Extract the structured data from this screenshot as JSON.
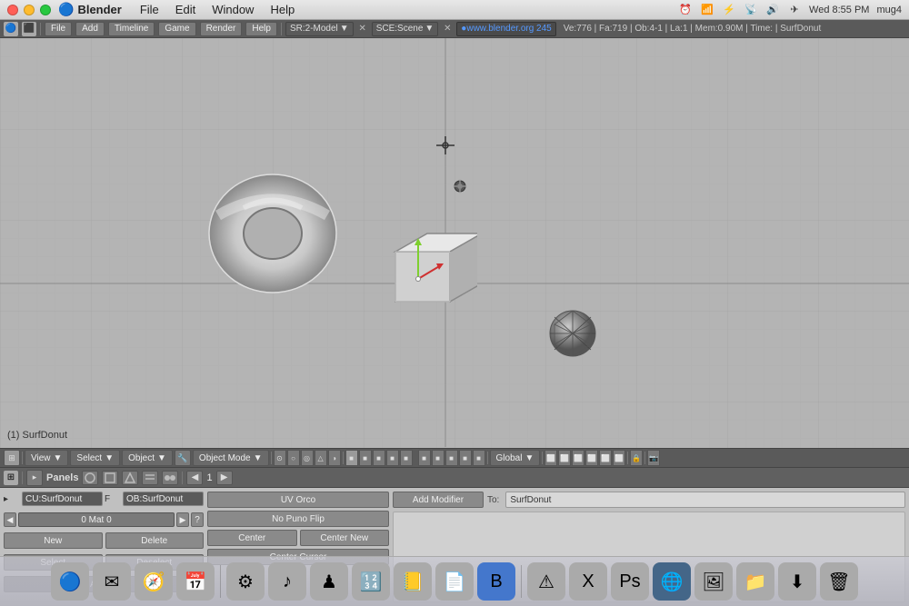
{
  "titlebar": {
    "app_name": "Blender",
    "window_menu": "Window",
    "time": "Wed 8:55 PM",
    "user": "mug4"
  },
  "macos_menu": {
    "apple_label": "",
    "app": "Blender",
    "items": [
      "File",
      "Edit",
      "Window",
      "Help"
    ]
  },
  "blender_header": {
    "title": "Blender",
    "menu_items": [
      "File",
      "Add",
      "Timeline",
      "Game",
      "Render",
      "Help"
    ],
    "sr_field": "SR:2-Model",
    "sce_field": "SCE:Scene",
    "url": "www.blender.org 245",
    "stats": "Ve:776 | Fa:719 | Ob:4-1 | La:1 | Mem:0.90M | Time: | SurfDonut"
  },
  "viewport": {
    "label": "(1) SurfDonut",
    "bg_color": "#b4b4b4"
  },
  "bottom_toolbar": {
    "mode_dropdown": "Object Mode",
    "coord_dropdown": "Global",
    "view_label": "View",
    "select_label": "Select",
    "object_label": "Object"
  },
  "panels_bar": {
    "label": "Panels",
    "nav_num": "1"
  },
  "properties": {
    "cu_field": "CU:SurfDonut",
    "f_label": "F",
    "ob_field": "OB:SurfDonut",
    "mat_label": "0 Mat 0",
    "new_btn": "New",
    "delete_btn": "Delete",
    "select_btn": "Select",
    "deselect_btn": "Deselect",
    "assign_btn": "Assign",
    "uv_orco_btn": "UV Orco",
    "no_puno_flip_btn": "No Puno Flip",
    "center_btn": "Center",
    "center_new_btn": "Center New",
    "center_cursor_btn": "Center Cursor",
    "add_modifier_btn": "Add Modifier",
    "to_label": "To:",
    "to_value": "SurfDonut"
  }
}
